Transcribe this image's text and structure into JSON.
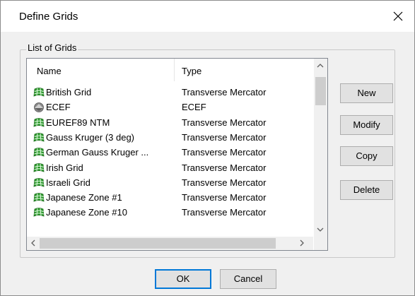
{
  "window": {
    "title": "Define Grids"
  },
  "group": {
    "label": "List of Grids"
  },
  "list": {
    "columns": [
      "Name",
      "Type"
    ],
    "rows": [
      {
        "name": "British Grid",
        "type": "Transverse Mercator",
        "icon": "grid-icon"
      },
      {
        "name": "ECEF",
        "type": "ECEF",
        "icon": "globe-icon"
      },
      {
        "name": "EUREF89 NTM",
        "type": "Transverse Mercator",
        "icon": "grid-icon"
      },
      {
        "name": "Gauss Kruger (3 deg)",
        "type": "Transverse Mercator",
        "icon": "grid-icon"
      },
      {
        "name": "German Gauss Kruger ...",
        "type": "Transverse Mercator",
        "icon": "grid-icon"
      },
      {
        "name": "Irish Grid",
        "type": "Transverse Mercator",
        "icon": "grid-icon"
      },
      {
        "name": "Israeli Grid",
        "type": "Transverse Mercator",
        "icon": "grid-icon"
      },
      {
        "name": "Japanese Zone #1",
        "type": "Transverse Mercator",
        "icon": "grid-icon"
      },
      {
        "name": "Japanese Zone #10",
        "type": "Transverse Mercator",
        "icon": "grid-icon"
      }
    ]
  },
  "buttons": {
    "new": "New",
    "modify": "Modify",
    "copy": "Copy",
    "delete": "Delete",
    "ok": "OK",
    "cancel": "Cancel"
  },
  "colors": {
    "grid_icon_green": "#2e9a2e",
    "default_button_border": "#0078d7"
  }
}
